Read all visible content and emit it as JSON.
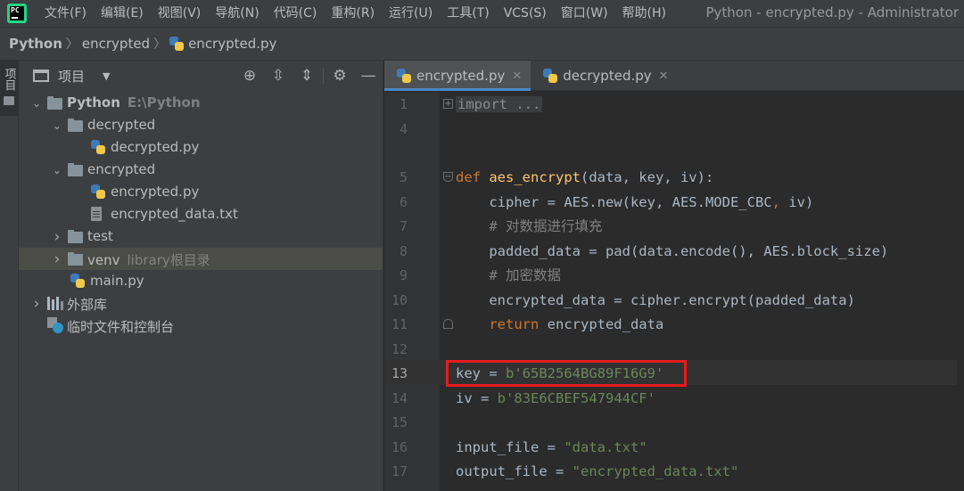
{
  "menu": {
    "items": [
      "文件(F)",
      "编辑(E)",
      "视图(V)",
      "导航(N)",
      "代码(C)",
      "重构(R)",
      "运行(U)",
      "工具(T)",
      "VCS(S)",
      "窗口(W)",
      "帮助(H)"
    ],
    "window_title": "Python - encrypted.py - Administrator",
    "app_icon_text": "PC"
  },
  "breadcrumbs": [
    "Python",
    "encrypted",
    "encrypted.py"
  ],
  "side_stripe": {
    "label": "项目"
  },
  "project_panel": {
    "title": "项目",
    "tools": [
      "locate-icon",
      "expand-all-icon",
      "collapse-all-icon",
      "gear-icon",
      "minimize-icon"
    ],
    "tree": [
      {
        "label": "Python",
        "hint": "E:\\Python",
        "type": "folder",
        "level": 0,
        "expanded": true,
        "bold": true
      },
      {
        "label": "decrypted",
        "type": "folder",
        "level": 1,
        "expanded": true
      },
      {
        "label": "decrypted.py",
        "type": "python",
        "level": 2
      },
      {
        "label": "encrypted",
        "type": "folder",
        "level": 1,
        "expanded": true
      },
      {
        "label": "encrypted.py",
        "type": "python",
        "level": 2
      },
      {
        "label": "encrypted_data.txt",
        "type": "text",
        "level": 2
      },
      {
        "label": "test",
        "type": "folder",
        "level": 1,
        "expanded": false
      },
      {
        "label": "venv",
        "hint": "library根目录",
        "type": "folder",
        "level": 1,
        "expanded": false,
        "selected": true
      },
      {
        "label": "main.py",
        "type": "python",
        "level": 1
      },
      {
        "label": "外部库",
        "type": "library",
        "level": 0,
        "expanded": false
      },
      {
        "label": "临时文件和控制台",
        "type": "scratch",
        "level": 0
      }
    ]
  },
  "editor": {
    "tabs": [
      {
        "label": "encrypted.py",
        "active": true
      },
      {
        "label": "decrypted.py",
        "active": false
      }
    ],
    "current_line": "13",
    "lines": [
      {
        "num": "1",
        "tokens": [
          [
            "folded",
            "import ..."
          ]
        ]
      },
      {
        "num": "4",
        "tokens": []
      },
      {
        "num": "",
        "tokens": []
      },
      {
        "num": "5",
        "tokens": [
          [
            "kw",
            "def "
          ],
          [
            "fn",
            "aes_encrypt"
          ],
          [
            "",
            "(data, key, iv):"
          ]
        ]
      },
      {
        "num": "6",
        "tokens": [
          [
            "",
            "    cipher = AES.new(key, AES.MODE_CBC"
          ],
          [
            "kw",
            ", "
          ],
          [
            "",
            "iv)"
          ]
        ]
      },
      {
        "num": "7",
        "tokens": [
          [
            "cm",
            "    # 对数据进行填充"
          ]
        ]
      },
      {
        "num": "8",
        "tokens": [
          [
            "",
            "    padded_data = pad(data.encode(), AES.block_size)"
          ]
        ]
      },
      {
        "num": "9",
        "tokens": [
          [
            "cm",
            "    # 加密数据"
          ]
        ]
      },
      {
        "num": "10",
        "tokens": [
          [
            "",
            "    encrypted_data = cipher.encrypt(padded_data)"
          ]
        ]
      },
      {
        "num": "11",
        "tokens": [
          [
            "kw",
            "    return "
          ],
          [
            "",
            "encrypted_data"
          ]
        ]
      },
      {
        "num": "12",
        "tokens": []
      },
      {
        "num": "13",
        "tokens": [
          [
            "",
            "key = "
          ],
          [
            "str",
            "b'65B2564BG89F16G9'"
          ]
        ]
      },
      {
        "num": "14",
        "tokens": [
          [
            "",
            "iv = "
          ],
          [
            "str",
            "b'83E6CBEF547944CF'"
          ]
        ]
      },
      {
        "num": "15",
        "tokens": []
      },
      {
        "num": "16",
        "tokens": [
          [
            "",
            "input_file = "
          ],
          [
            "str",
            "\"data.txt\""
          ]
        ]
      },
      {
        "num": "17",
        "tokens": [
          [
            "",
            "output_file = "
          ],
          [
            "str",
            "\"encrypted_data.txt\""
          ]
        ]
      }
    ],
    "highlight_color": "#e81c1c"
  },
  "colors": {
    "background": "#2b2b2b",
    "panel": "#3c3f41",
    "accent": "#4a88c7",
    "keyword": "#cc7832",
    "function": "#ffc66d",
    "string": "#6a8759",
    "comment": "#808080"
  }
}
